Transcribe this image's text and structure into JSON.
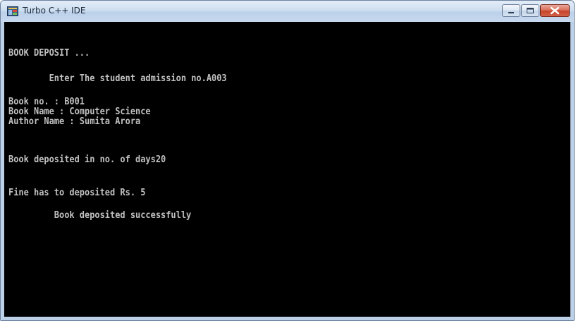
{
  "window": {
    "title": "Turbo C++ IDE"
  },
  "icons": {
    "app": "turbo-cpp-app-icon",
    "minimize": "minimize-icon",
    "maximize": "maximize-icon",
    "close": "close-icon"
  },
  "colors": {
    "console_bg": "#000000",
    "console_text": "#c0c0c0",
    "close_button": "#c7432a"
  },
  "console": {
    "heading": "BOOK DEPOSIT ...",
    "admission_prompt": "        Enter The student admission no.A003",
    "book_no": "Book no. : B001",
    "book_name": "Book Name : Computer Science",
    "author_name": "Author Name : Sumita Arora",
    "days": "Book deposited in no. of days20",
    "fine": "Fine has to deposited Rs. 5",
    "success": "         Book deposited successfully"
  }
}
